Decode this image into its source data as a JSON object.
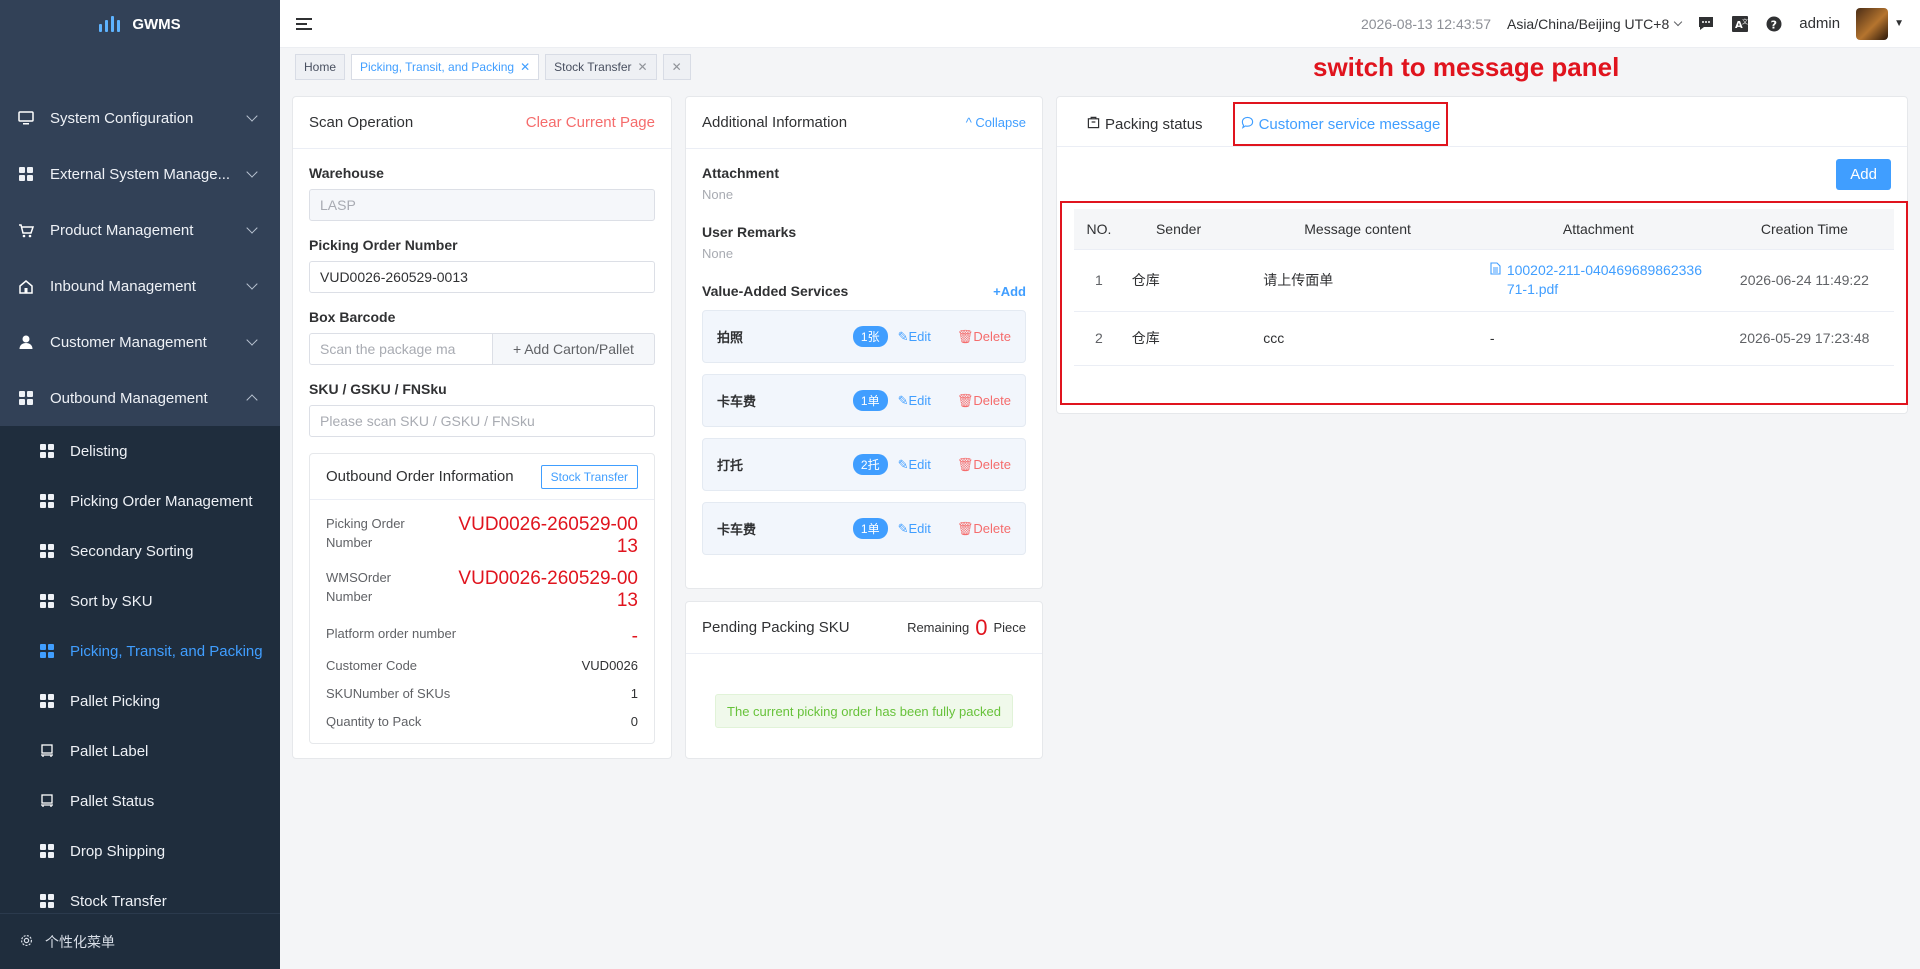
{
  "app": {
    "name": "GWMS"
  },
  "sidebar": {
    "menus": [
      {
        "label": "System Configuration"
      },
      {
        "label": "External System Manage..."
      },
      {
        "label": "Product Management"
      },
      {
        "label": "Inbound Management"
      },
      {
        "label": "Customer Management"
      },
      {
        "label": "Outbound Management"
      }
    ],
    "sub_items": [
      {
        "label": "Delisting"
      },
      {
        "label": "Picking Order Management"
      },
      {
        "label": "Secondary Sorting"
      },
      {
        "label": "Sort by SKU"
      },
      {
        "label": "Picking, Transit, and Packing"
      },
      {
        "label": "Pallet Picking"
      },
      {
        "label": "Pallet Label"
      },
      {
        "label": "Pallet Status"
      },
      {
        "label": "Drop Shipping"
      },
      {
        "label": "Stock Transfer"
      }
    ],
    "footer": "个性化菜单",
    "active_color": "#409eff"
  },
  "header": {
    "time": "2026-08-13 12:43:57",
    "timezone": "Asia/China/Beijing UTC+8",
    "user": "admin"
  },
  "tags": [
    {
      "label": "Home"
    },
    {
      "label": "Picking, Transit, and Packing"
    },
    {
      "label": "Stock Transfer"
    }
  ],
  "annotation": "switch to message panel",
  "scan": {
    "title": "Scan Operation",
    "clear": "Clear Current Page",
    "warehouse_label": "Warehouse",
    "warehouse_value": "LASP",
    "picking_label": "Picking Order Number",
    "picking_value": "VUD0026-260529-0013",
    "box_label": "Box Barcode",
    "box_placeholder": "Scan the package ma",
    "add_carton": "Add Carton/Pallet",
    "sku_label": "SKU / GSKU / FNSku",
    "sku_placeholder": "Please scan SKU / GSKU / FNSku",
    "order_info": {
      "title": "Outbound Order Information",
      "stock_transfer": "Stock Transfer",
      "picking_label": "Picking Order Number",
      "picking_value": "VUD0026-260529-0013",
      "wms_label": "WMSOrder Number",
      "wms_value": "VUD0026-260529-0013",
      "platform_label": "Platform order number",
      "platform_value": "-",
      "customer_label": "Customer Code",
      "customer_value": "VUD0026",
      "skus_label": "SKUNumber of SKUs",
      "skus_value": "1",
      "qty_label": "Quantity to Pack",
      "qty_value": "0"
    }
  },
  "additional": {
    "title": "Additional Information",
    "collapse": "Collapse",
    "attachment_label": "Attachment",
    "attachment_value": "None",
    "remarks_label": "User Remarks",
    "remarks_value": "None",
    "vas_label": "Value-Added Services",
    "vas_add": "+Add",
    "edit": "Edit",
    "delete": "Delete",
    "services": [
      {
        "name": "拍照",
        "qty": "1张"
      },
      {
        "name": "卡车费",
        "qty": "1单"
      },
      {
        "name": "打托",
        "qty": "2托"
      },
      {
        "name": "卡车费",
        "qty": "1单"
      }
    ]
  },
  "pending": {
    "title": "Pending Packing SKU",
    "remaining": "Remaining",
    "count": "0",
    "unit": "Piece",
    "message": "The current picking order has been fully packed"
  },
  "panel": {
    "tab_packing": "Packing status",
    "tab_message": "Customer service message",
    "add": "Add",
    "columns": [
      "NO.",
      "Sender",
      "Message content",
      "Attachment",
      "Creation Time"
    ],
    "rows": [
      {
        "no": "1",
        "sender": "仓库",
        "content": "请上传面单",
        "attachment": "100202-211-04046968986233671-1.pdf",
        "time": "2026-06-24 11:49:22"
      },
      {
        "no": "2",
        "sender": "仓库",
        "content": "ccc",
        "attachment": "-",
        "time": "2026-05-29 17:23:48"
      }
    ]
  }
}
